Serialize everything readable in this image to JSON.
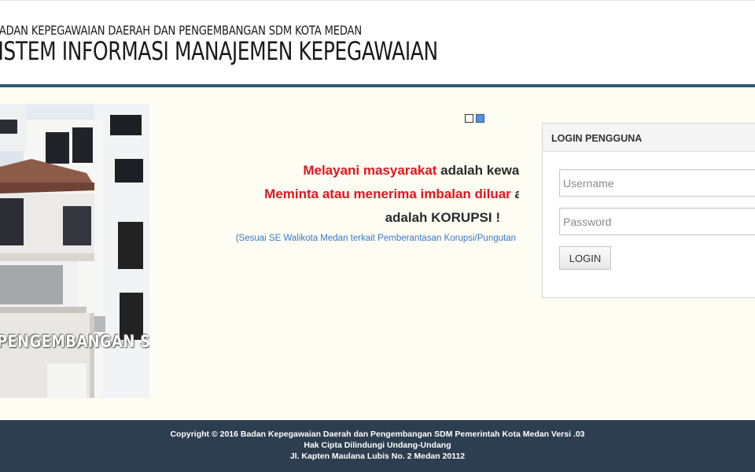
{
  "header": {
    "org_name": "BADAN KEPEGAWAIAN DAERAH DAN PENGEMBANGAN SDM KOTA MEDAN",
    "app_name": "SISTEM INFORMASI MANAJEMEN KEPEGAWAIAN",
    "rule_color": "#2a5a78"
  },
  "banner": {
    "caption": "PENGEMBANGAN SDM"
  },
  "slider": {
    "dots": 2,
    "active_index": 1
  },
  "message": {
    "line1_red": "Melayani masyarakat",
    "line1_dark": " adalah kewajiban",
    "line2_red": "Meminta atau menerima imbalan diluar",
    "line2_dark": " a",
    "line3": "adalah KORUPSI !",
    "line4": "(Sesuai SE Walikota Medan terkait Pemberantasan Korupsi/Pungutan"
  },
  "login": {
    "title": "LOGIN PENGGUNA",
    "username_placeholder": "Username",
    "password_placeholder": "Password",
    "button_label": "LOGIN"
  },
  "footer": {
    "line1": "Copyright © 2016 Badan Kepegawaian Daerah dan Pengembangan SDM Pemerintah Kota Medan Versi .03",
    "line2": "Hak Cipta Dilindungi Undang-Undang",
    "line3": "Jl. Kapten Maulana Lubis No. 2 Medan 20112",
    "background": "#2d3e50"
  },
  "colors": {
    "accent_red": "#e0161d",
    "link_blue": "#3a78c8",
    "main_bg": "#fdfdf3"
  }
}
